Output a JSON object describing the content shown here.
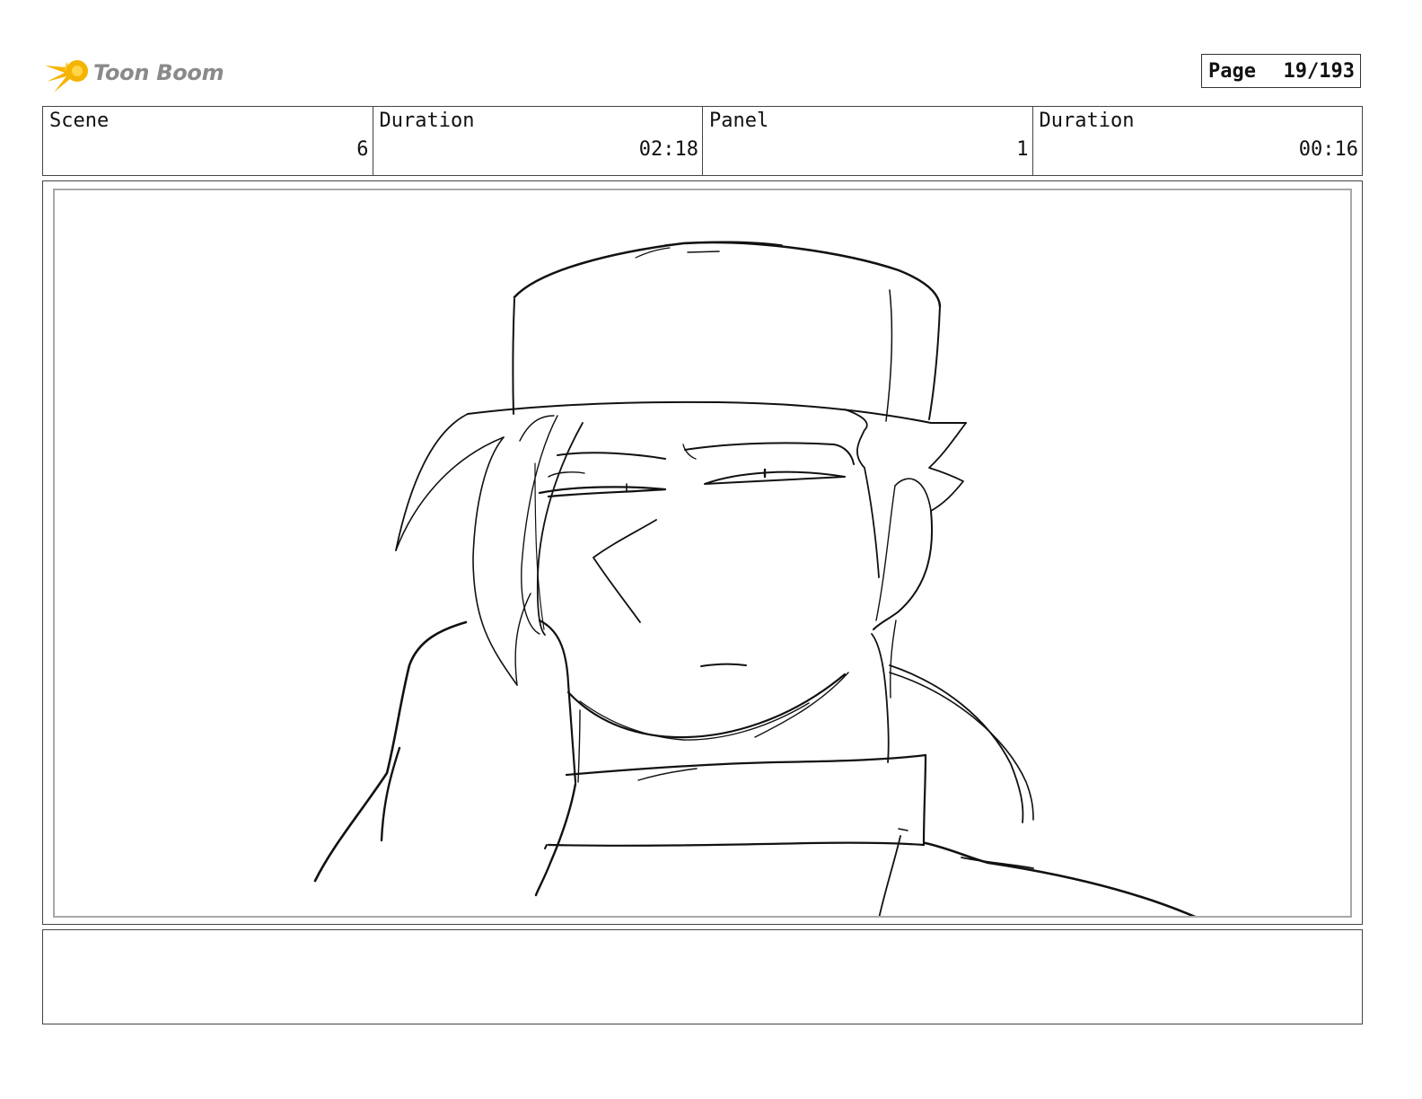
{
  "header": {
    "logo_text": "Toon Boom",
    "logo_icon": "starburst-icon",
    "page_label": "Page",
    "page_value": "19/193"
  },
  "info": {
    "scene_label": "Scene",
    "scene_value": "6",
    "scene_duration_label": "Duration",
    "scene_duration_value": "02:18",
    "panel_label": "Panel",
    "panel_value": "1",
    "panel_duration_label": "Duration",
    "panel_duration_value": "00:16"
  },
  "drawing": {
    "subject": "sketch-character-with-hat",
    "stroke_color": "#111111"
  },
  "notes": {
    "text": ""
  }
}
